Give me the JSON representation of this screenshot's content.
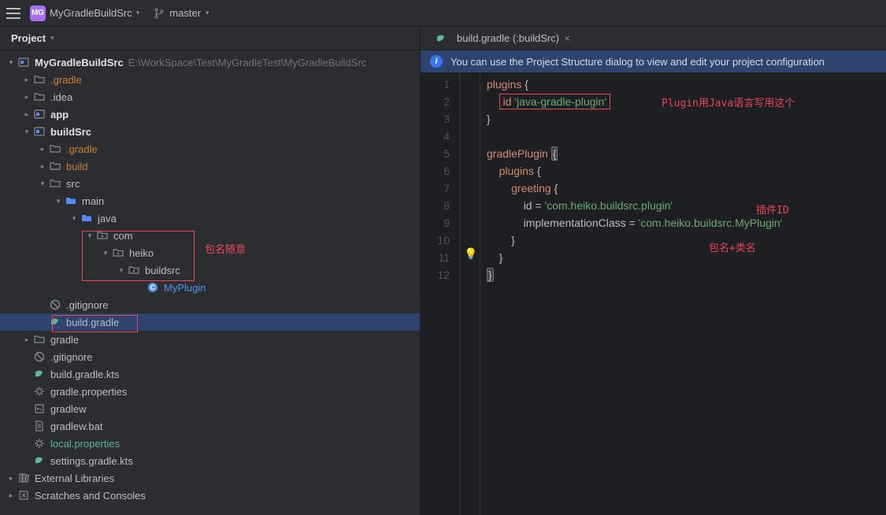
{
  "topbar": {
    "project_badge": "MG",
    "project_name": "MyGradleBuildSrc",
    "branch": "master"
  },
  "project_panel": {
    "title": "Project",
    "root": {
      "name": "MyGradleBuildSrc",
      "path": "E:\\WorkSpace\\Test\\MyGradleTest\\MyGradleBuildSrc"
    },
    "nodes": {
      "gradle": ".gradle",
      "idea": ".idea",
      "app": "app",
      "buildSrc": "buildSrc",
      "bs_gradle": ".gradle",
      "bs_build": "build",
      "bs_src": "src",
      "bs_main": "main",
      "bs_java": "java",
      "bs_com": "com",
      "bs_heiko": "heiko",
      "bs_buildsrc": "buildsrc",
      "bs_myplugin": "MyPlugin",
      "bs_gitignore": ".gitignore",
      "bs_buildgradle": "build.gradle",
      "root_gradle": "gradle",
      "root_gitignore": ".gitignore",
      "root_bgkts": "build.gradle.kts",
      "root_gprops": "gradle.properties",
      "root_gradlew": "gradlew",
      "root_gradlewbat": "gradlew.bat",
      "root_localprops": "local.properties",
      "root_settingskts": "settings.gradle.kts",
      "ext_libs": "External Libraries",
      "scratches": "Scratches and Consoles"
    }
  },
  "annotations": {
    "pkg_any": "包名随意",
    "plugin_java": "Plugin用Java语言写用这个",
    "plugin_id": "插件ID",
    "pkg_class": "包名+类名"
  },
  "editor": {
    "tab_title": "build.gradle (:buildSrc)",
    "banner": "You can use the Project Structure dialog to view and edit your project configuration",
    "lines": {
      "l1_a": "plugins",
      "l1_b": "{",
      "l2_a": "id",
      "l2_b": "'java-gradle-plugin'",
      "l3": "}",
      "l5_a": "gradlePlugin",
      "l5_b": "{",
      "l6_a": "plugins",
      "l6_b": "{",
      "l7_a": "greeting",
      "l7_b": "{",
      "l8_a": "id = ",
      "l8_b": "'com.heiko.buildsrc.plugin'",
      "l9_a": "implementationClass = ",
      "l9_b": "'com.heiko.buildsrc.MyPlugin'",
      "l10": "}",
      "l11": "}",
      "l12": "}"
    },
    "line_numbers": [
      "1",
      "2",
      "3",
      "4",
      "5",
      "6",
      "7",
      "8",
      "9",
      "10",
      "11",
      "12"
    ]
  }
}
